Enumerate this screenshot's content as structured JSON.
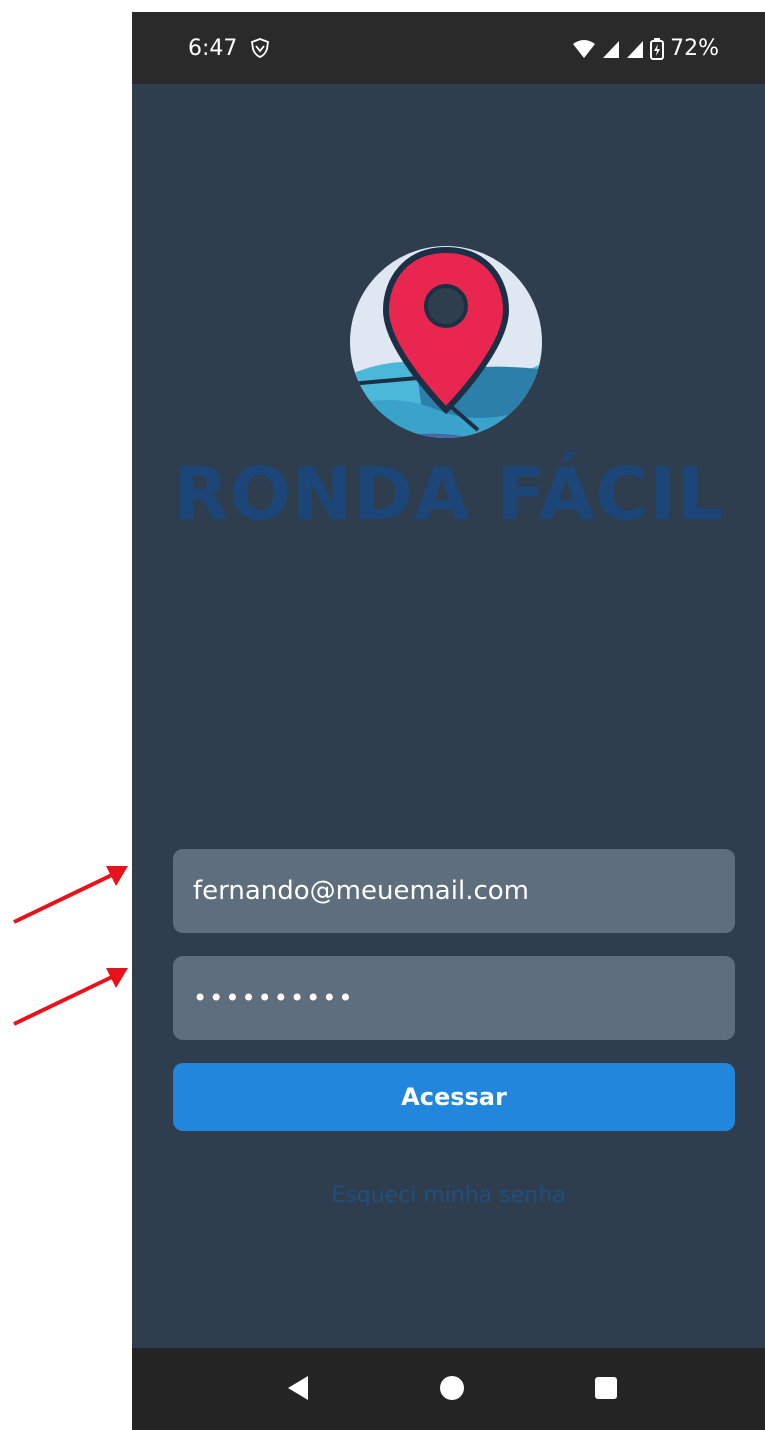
{
  "status_bar": {
    "time": "6:47",
    "battery": "72%",
    "icons": [
      "shield-icon",
      "wifi-icon",
      "signal-icon",
      "signal-icon",
      "battery-icon"
    ]
  },
  "brand": {
    "name": "RONDA FÁCIL",
    "colors": {
      "pin": "#e8264f",
      "wordmark": "#1c4677",
      "wave_light": "#4bb8d9",
      "wave_dark": "#2c7fa8"
    }
  },
  "login": {
    "email_value": "fernando@meuemail.com",
    "password_value": "••••••••••",
    "submit_label": "Acessar",
    "forgot_label": "Esqueci minha senha"
  },
  "nav_bar": {
    "icons": [
      "back-icon",
      "home-icon",
      "recent-apps-icon"
    ]
  },
  "colors": {
    "background": "#2f3e4f",
    "field": "#5e6e7c",
    "button": "#2186dc",
    "annotation_arrow": "#e8121c"
  }
}
